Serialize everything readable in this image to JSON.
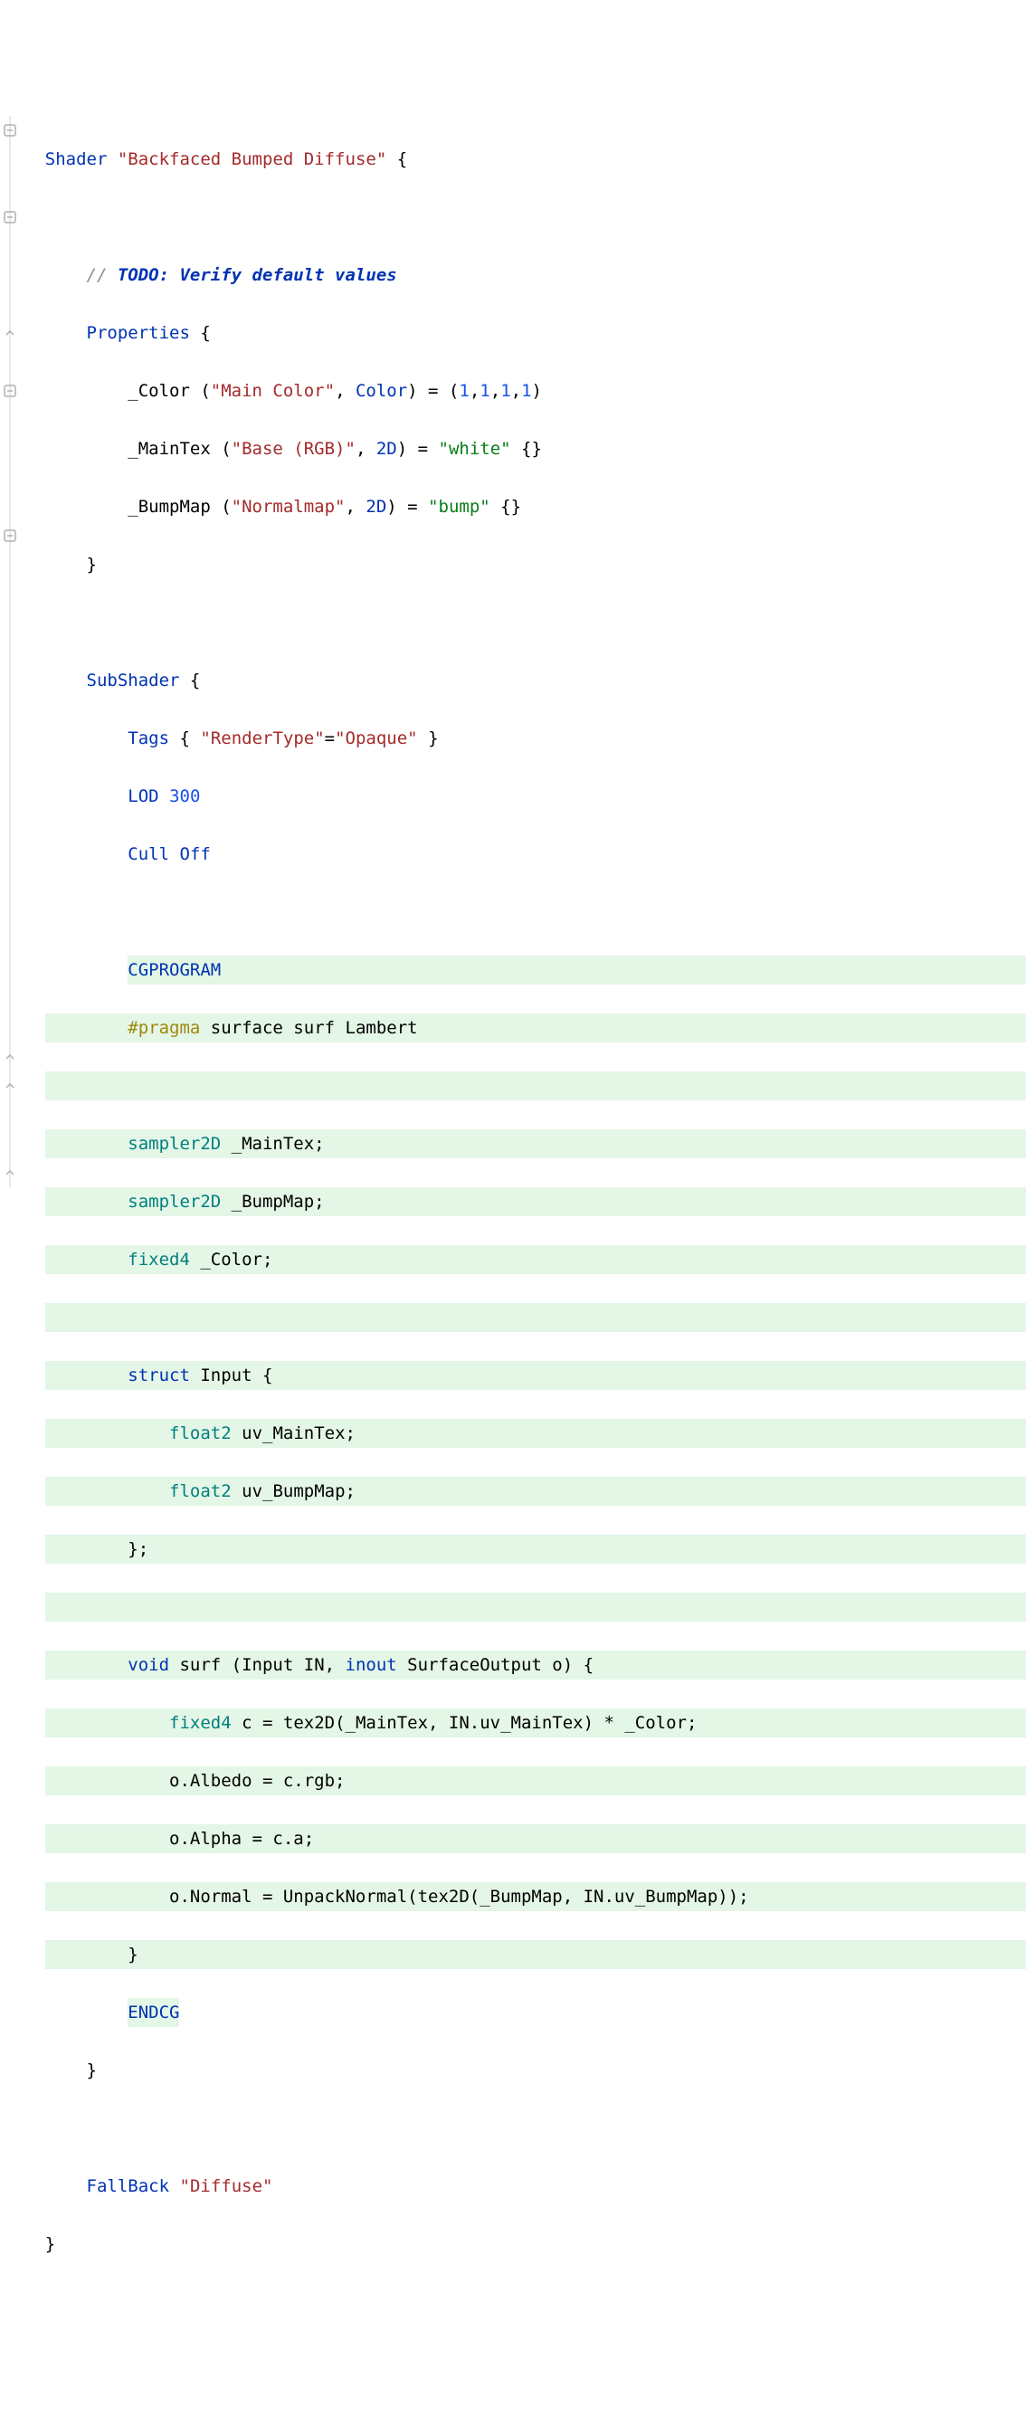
{
  "lines": {
    "l1": {
      "t1": "Shader ",
      "s1": "\"Backfaced Bumped Diffuse\"",
      "t2": " {"
    },
    "l2": "",
    "l3": {
      "c1": "    // ",
      "todo": "TODO: Verify default values"
    },
    "l4": {
      "t1": "    ",
      "kw": "Properties",
      "t2": " {"
    },
    "l5": {
      "t1": "        _Color (",
      "s1": "\"Main Color\"",
      "t2": ", ",
      "kw": "Color",
      "t3": ") = (",
      "n1": "1",
      "t4": ",",
      "n2": "1",
      "t5": ",",
      "n3": "1",
      "t6": ",",
      "n4": "1",
      "t7": ")"
    },
    "l6": {
      "t1": "        _MainTex (",
      "s1": "\"Base (RGB)\"",
      "t2": ", ",
      "kw": "2D",
      "t3": ") = ",
      "s2": "\"white\"",
      "t4": " {}"
    },
    "l7": {
      "t1": "        _BumpMap (",
      "s1": "\"Normalmap\"",
      "t2": ", ",
      "kw": "2D",
      "t3": ") = ",
      "s2": "\"bump\"",
      "t4": " {}"
    },
    "l8": "    }",
    "l9": "",
    "l10": {
      "t1": "    ",
      "kw": "SubShader",
      "t2": " {"
    },
    "l11": {
      "t1": "        ",
      "kw": "Tags",
      "t2": " { ",
      "s1": "\"RenderType\"",
      "t3": "=",
      "s2": "\"Opaque\"",
      "t4": " }"
    },
    "l12": {
      "t1": "        ",
      "kw": "LOD",
      "t2": " ",
      "n1": "300"
    },
    "l13": {
      "t1": "        ",
      "kw1": "Cull",
      "t2": " ",
      "kw2": "Off"
    },
    "l14": "",
    "l15": {
      "t1": "        ",
      "kw": "CGPROGRAM"
    },
    "l16": {
      "t1": "        ",
      "pr": "#pragma",
      "t2": " surface surf Lambert"
    },
    "l17": "",
    "l18": {
      "t1": "        ",
      "ty": "sampler2D",
      "t2": " _MainTex;"
    },
    "l19": {
      "t1": "        ",
      "ty": "sampler2D",
      "t2": " _BumpMap;"
    },
    "l20": {
      "t1": "        ",
      "ty": "fixed4",
      "t2": " _Color;"
    },
    "l21": "",
    "l22": {
      "t1": "        ",
      "kw": "struct",
      "t2": " Input {"
    },
    "l23": {
      "t1": "            ",
      "ty": "float2",
      "t2": " uv_MainTex;"
    },
    "l24": {
      "t1": "            ",
      "ty": "float2",
      "t2": " uv_BumpMap;"
    },
    "l25": "        };",
    "l26": "",
    "l27": {
      "t1": "        ",
      "kw": "void",
      "t2": " surf (Input IN, ",
      "kw2": "inout",
      "t3": " SurfaceOutput o) {"
    },
    "l28": {
      "t1": "            ",
      "ty": "fixed4",
      "t2": " c = tex2D(_MainTex, IN.uv_MainTex) * _Color;"
    },
    "l29": "            o.Albedo = c.rgb;",
    "l30": "            o.Alpha = c.a;",
    "l31": "            o.Normal = UnpackNormal(tex2D(_BumpMap, IN.uv_BumpMap));",
    "l32": "        }",
    "l33": {
      "t1": "        ",
      "kw": "ENDCG"
    },
    "l34": "    }",
    "l35": "",
    "l36": {
      "t1": "    ",
      "kw": "FallBack",
      "t2": " ",
      "s1": "\"Diffuse\""
    },
    "l37": "}"
  },
  "fold_icons": {
    "minus": "⊟",
    "arrow": "⌃"
  }
}
